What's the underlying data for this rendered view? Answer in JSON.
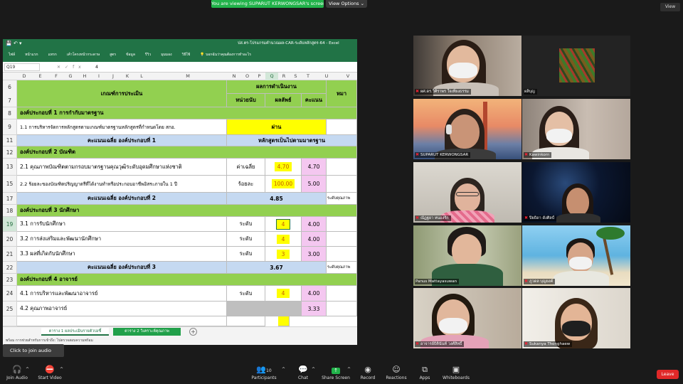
{
  "banner": {
    "text": "You are viewing SUPARUT KERWONGSAR's screen",
    "view_options": "View Options ⌄",
    "view": "View"
  },
  "excel": {
    "title": "ปส.ตร-โปรแกรมคำนวณผล-CAR-ระดับหลักสูตร-64 - Excel",
    "ribbon": [
      "ไฟล์",
      "หน้าแรก",
      "แทรก",
      "เค้าโครงหน้ากระดาษ",
      "สูตร",
      "ข้อมูล",
      "รีวิว",
      "มุมมอง",
      "วิธีใช้",
      "บอกฉันว่าคุณต้องการทำอะไร"
    ],
    "namebox": "Q19",
    "fx": "fx",
    "formula_value": "4",
    "columns": [
      "D",
      "E",
      "F",
      "G",
      "H",
      "I",
      "J",
      "K",
      "L",
      "M",
      "N",
      "O",
      "P",
      "Q",
      "R",
      "S",
      "T",
      "U",
      "V"
    ],
    "header": {
      "criteria": "เกณฑ์การประเมิน",
      "results": "ผลการดำเนินงาน",
      "unit": "หน่วยนับ",
      "output": "ผลลัพธ์",
      "score": "คะแนน",
      "note": "หมา"
    },
    "rows": [
      {
        "n": "8",
        "type": "section",
        "text": "องค์ประกอบที่ 1 การกำกับมาตรฐาน"
      },
      {
        "n": "9",
        "type": "item",
        "text": "1.1 การบริหารจัดการหลักสูตรตามเกณฑ์มาตรฐานหลักสูตรที่กำหนดโดย สกอ.",
        "pass": "ผ่าน"
      },
      {
        "n": "11",
        "type": "avg",
        "text": "คะแนนเฉลี่ย องค์ประกอบที่ 1",
        "result": "หลักสูตรเป็นไปตามมาตรฐาน"
      },
      {
        "n": "12",
        "type": "section",
        "text": "องค์ประกอบที่ 2 บัณฑิต"
      },
      {
        "n": "13",
        "type": "item",
        "text": "2.1 คุณภาพบัณฑิตตามกรอบมาตรฐานคุณวุฒิระดับอุดมศึกษาแห่งชาติ",
        "unit": "ค่าเฉลี่ย",
        "output": "4.70",
        "score": "4.70"
      },
      {
        "n": "15",
        "type": "item",
        "text": "2.2 ร้อยละของบัณฑิตปริญญาตรีที่ได้งานทำหรือประกอบอาชีพอิสระภายใน 1 ปี",
        "unit": "ร้อยละ",
        "output": "100.00",
        "score": "5.00"
      },
      {
        "n": "17",
        "type": "avg",
        "text": "คะแนนเฉลี่ย องค์ประกอบที่ 2",
        "result": "4.85",
        "note": "ระดับคุณภาพ"
      },
      {
        "n": "18",
        "type": "section",
        "text": "องค์ประกอบที่ 3 นักศึกษา"
      },
      {
        "n": "19",
        "type": "item",
        "text": "3.1 การรับนักศึกษา",
        "unit": "ระดับ",
        "output": "4",
        "score": "4.00"
      },
      {
        "n": "20",
        "type": "item",
        "text": "3.2 การส่งเสริมและพัฒนานักศึกษา",
        "unit": "ระดับ",
        "output": "4",
        "score": "4.00"
      },
      {
        "n": "21",
        "type": "item",
        "text": "3.3 ผลที่เกิดกับนักศึกษา",
        "unit": "ระดับ",
        "output": "3",
        "score": "3.00"
      },
      {
        "n": "22",
        "type": "avg",
        "text": "คะแนนเฉลี่ย องค์ประกอบที่ 3",
        "result": "3.67",
        "note": "ระดับคุณภาพ"
      },
      {
        "n": "23",
        "type": "section",
        "text": "องค์ประกอบที่ 4 อาจารย์"
      },
      {
        "n": "24",
        "type": "item",
        "text": "4.1 การบริหารและพัฒนาอาจารย์",
        "unit": "ระดับ",
        "output": "4",
        "score": "4.00"
      },
      {
        "n": "25",
        "type": "item_gray",
        "text": "4.2 คุณภาพอาจารย์",
        "score": "3.33"
      }
    ],
    "tabs": [
      "ตาราง 1 ผลประเมินรายตัวบ่งชี้",
      "ตาราง 2 วิเคราะห์คุณภาพ"
    ],
    "status": "พร้อม   การช่วยสำหรับการเข้าถึง: ไปตรวจสอบความพร้อม"
  },
  "tooltip": "Click to join audio",
  "tiles": [
    {
      "name": "ผศ.ดร.วิศิราพร ใจเที่ยงธรรม",
      "muted": true
    },
    {
      "name": "ผลิบุญ",
      "muted": false
    },
    {
      "name": "SUPARUT KERWONGSAR",
      "muted": true
    },
    {
      "name": "Kawinkorn",
      "muted": true
    },
    {
      "name": "ณัฏฐยา หนองรัก",
      "muted": true
    },
    {
      "name": "ปิยธิดา ดังศิลป์",
      "muted": true
    },
    {
      "name": "Panus Mattayasuwan",
      "muted": false
    },
    {
      "name": "ภูวดล บุญยงค์",
      "muted": true
    },
    {
      "name": "อาจารย์ธิตินันท์ วงศ์สิทธิ์",
      "muted": true
    },
    {
      "name": "Sukanya Thonghaew",
      "muted": true
    }
  ],
  "toolbar": {
    "join_audio": "Join Audio",
    "start_video": "Start Video",
    "participants": "Participants",
    "participants_count": "10",
    "chat": "Chat",
    "share_screen": "Share Screen",
    "record": "Record",
    "reactions": "Reactions",
    "apps": "Apps",
    "whiteboards": "Whiteboards",
    "leave": "Leave"
  }
}
